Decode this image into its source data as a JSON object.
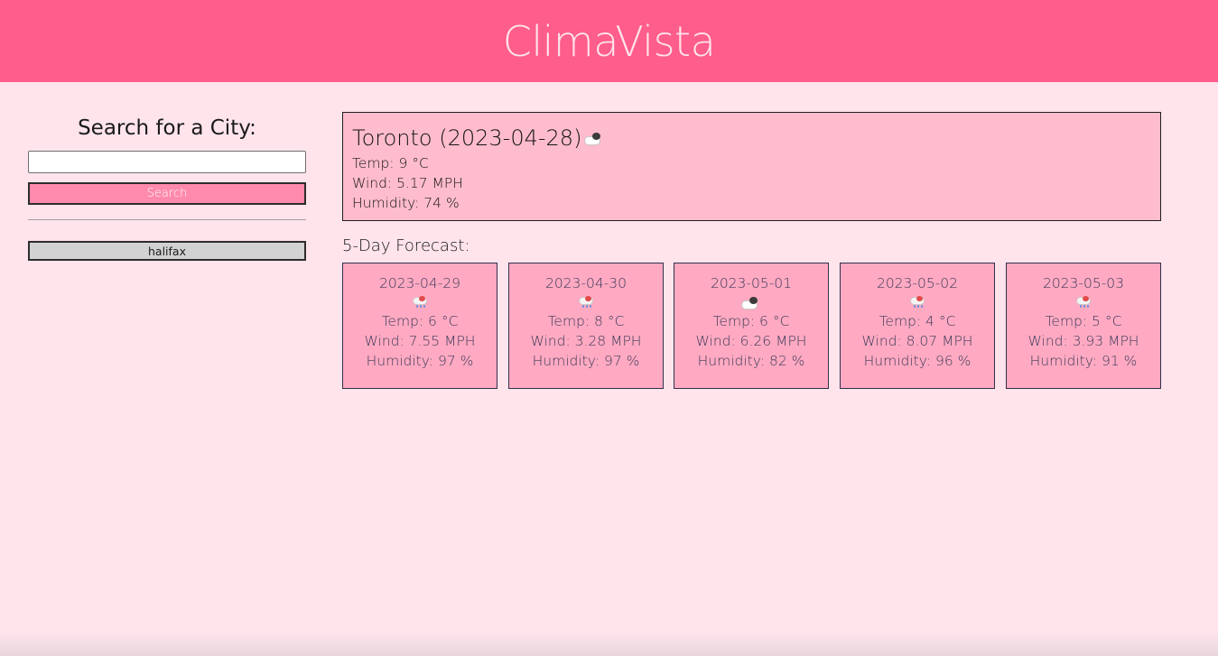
{
  "app": {
    "title": "ClimaVista"
  },
  "search": {
    "heading": "Search for a City:",
    "input_value": "",
    "button_label": "Search"
  },
  "history": [
    "halifax"
  ],
  "current": {
    "title": "Toronto (2023-04-28)",
    "icon": "cloud-icon",
    "temp": "Temp: 9 °C",
    "wind": "Wind: 5.17 MPH",
    "humidity": "Humidity: 74 %"
  },
  "forecast": {
    "heading": "5-Day Forecast:",
    "days": [
      {
        "date": "2023-04-29",
        "icon": "rain-icon",
        "temp": "Temp: 6 °C",
        "wind": "Wind: 7.55 MPH",
        "humidity": "Humidity: 97 %"
      },
      {
        "date": "2023-04-30",
        "icon": "rain-icon",
        "temp": "Temp: 8 °C",
        "wind": "Wind: 3.28 MPH",
        "humidity": "Humidity: 97 %"
      },
      {
        "date": "2023-05-01",
        "icon": "cloud-icon",
        "temp": "Temp: 6 °C",
        "wind": "Wind: 6.26 MPH",
        "humidity": "Humidity: 82 %"
      },
      {
        "date": "2023-05-02",
        "icon": "rain-icon",
        "temp": "Temp: 4 °C",
        "wind": "Wind: 8.07 MPH",
        "humidity": "Humidity: 96 %"
      },
      {
        "date": "2023-05-03",
        "icon": "rain-icon",
        "temp": "Temp: 5 °C",
        "wind": "Wind: 3.93 MPH",
        "humidity": "Humidity: 91 %"
      }
    ]
  },
  "colors": {
    "header_bg": "#ff5d8b",
    "page_bg": "#ffe4ec",
    "current_bg": "#ffbccd",
    "card_bg": "#ffaac2",
    "search_button_bg": "#ff8aab",
    "history_button_bg": "#d2d2d2"
  }
}
